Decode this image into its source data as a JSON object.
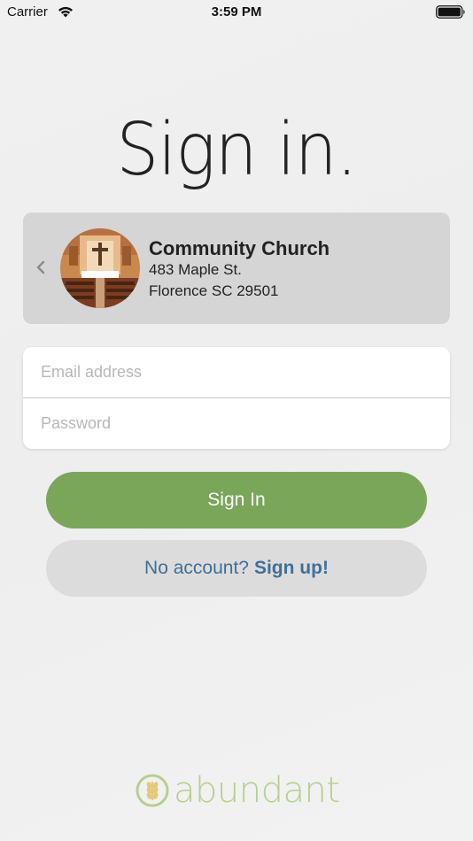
{
  "status_bar": {
    "carrier": "Carrier",
    "time": "3:59 PM",
    "wifi_icon": "wifi-icon",
    "battery_icon": "battery-icon"
  },
  "page": {
    "title": "Sign in."
  },
  "church": {
    "name": "Community Church",
    "address_line1": "483 Maple St.",
    "address_line2": "Florence SC 29501",
    "photo_icon": "church-interior-photo",
    "back_icon": "chevron-left-icon"
  },
  "form": {
    "email_placeholder": "Email address",
    "email_value": "",
    "password_placeholder": "Password",
    "password_value": ""
  },
  "buttons": {
    "sign_in_label": "Sign In",
    "no_account_text": "No account?",
    "sign_up_link": "Sign up!"
  },
  "brand": {
    "logo_text": "abundant"
  },
  "colors": {
    "primary_green": "#7aa65a",
    "link_blue": "#3f6f99",
    "card_gray": "#d5d5d5",
    "logo_green": "#b7cf8e"
  }
}
